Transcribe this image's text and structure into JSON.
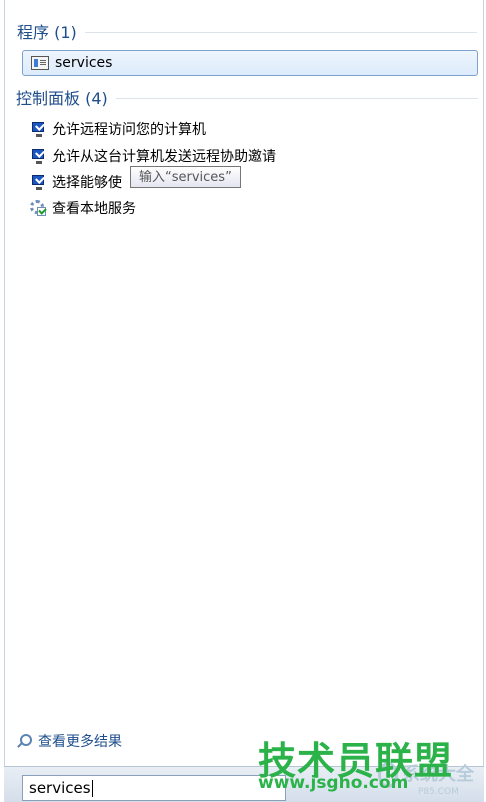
{
  "programs": {
    "header": "程序 (1)",
    "items": [
      {
        "label": "services",
        "icon": "services-app-icon"
      }
    ]
  },
  "control_panel": {
    "header": "控制面板 (4)",
    "items": [
      {
        "label": "允许远程访问您的计算机",
        "icon": "monitor-check-icon"
      },
      {
        "label": "允许从这台计算机发送远程协助邀请",
        "icon": "monitor-check-icon"
      },
      {
        "label": "选择能够使",
        "icon": "monitor-check-icon"
      },
      {
        "label": "查看本地服务",
        "icon": "services-gear-icon"
      }
    ]
  },
  "tooltip": {
    "text": "输入“services”"
  },
  "more_results": {
    "label": "查看更多结果"
  },
  "search": {
    "value": "services"
  },
  "watermark": {
    "main": "技术员联盟",
    "url": "www.jsgho.com",
    "secondary": "系统大全",
    "secondary_url": "P85.COM"
  }
}
